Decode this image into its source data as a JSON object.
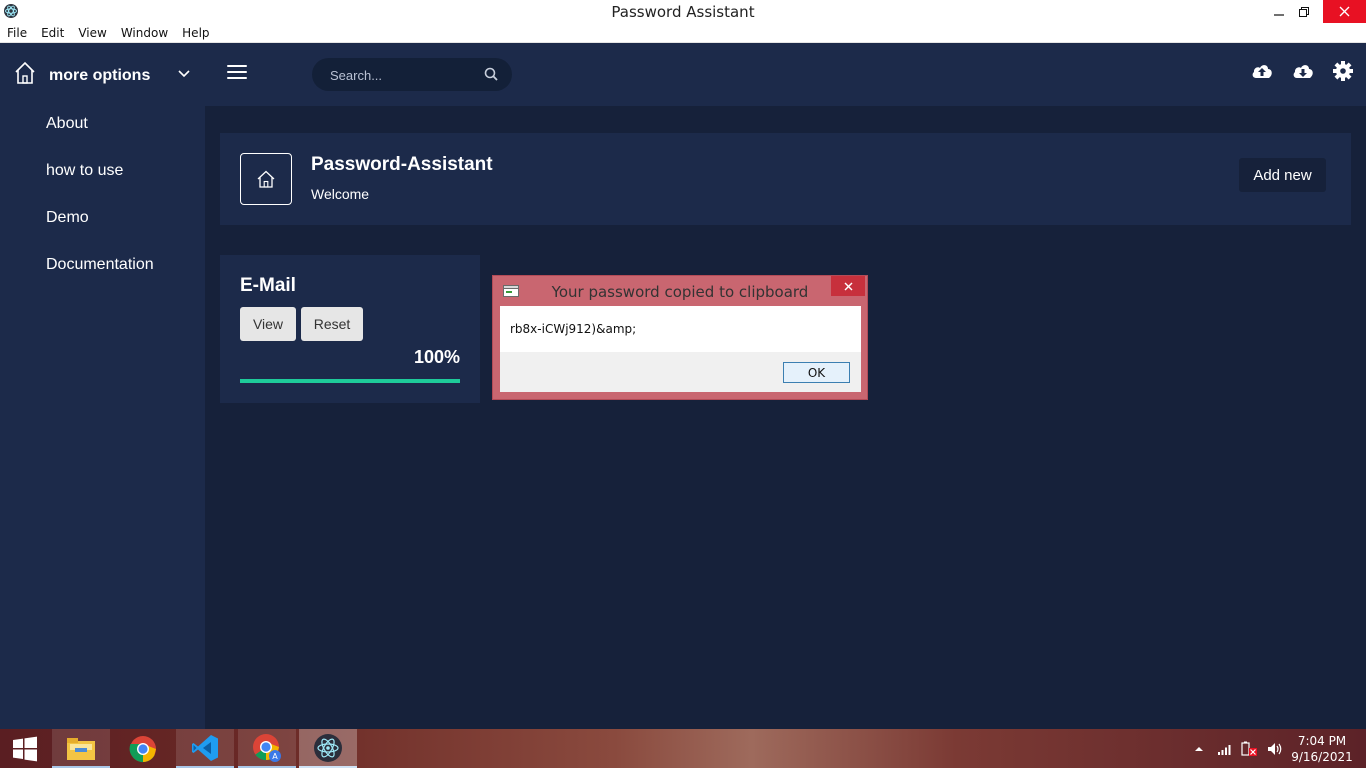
{
  "window": {
    "title": "Password Assistant"
  },
  "menu": [
    "File",
    "Edit",
    "View",
    "Window",
    "Help"
  ],
  "sidebar": {
    "brand": "more options",
    "items": [
      {
        "label": "About"
      },
      {
        "label": "how to use"
      },
      {
        "label": "Demo"
      },
      {
        "label": "Documentation"
      }
    ]
  },
  "header": {
    "search_placeholder": "Search...",
    "icons": [
      "cloud-upload-icon",
      "cloud-download-icon",
      "gear-icon"
    ]
  },
  "page": {
    "title": "Password-Assistant",
    "subtitle": "Welcome",
    "add_new_label": "Add new"
  },
  "card": {
    "title": "E-Mail",
    "view_label": "View",
    "reset_label": "Reset",
    "progress_text": "100%",
    "progress_value": 1.0,
    "progress_color": "#1ecb9a"
  },
  "dialog": {
    "title": "Your password copied to clipboard",
    "message": "rb8x-iCWj912)&amp;",
    "ok_label": "OK"
  },
  "taskbar": {
    "apps": [
      "windows-start-icon",
      "file-explorer-icon",
      "chrome-icon",
      "vscode-icon",
      "chrome-profile-icon",
      "electron-app-icon"
    ],
    "time": "7:04 PM",
    "date": "9/16/2021"
  },
  "colors": {
    "background": "#16213a",
    "panel": "#1c2a4a",
    "accent": "#1ecb9a",
    "dialog_frame": "#c96670"
  }
}
